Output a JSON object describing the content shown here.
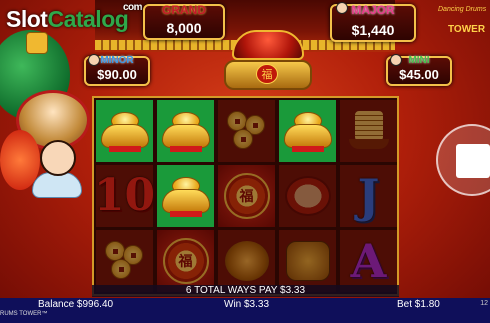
{
  "logo": {
    "slot": "Slot",
    "catalog": "Catalog",
    "com": "com"
  },
  "game_logo": {
    "line1": "Dancing Drums",
    "line2": "TOWER"
  },
  "jackpots": {
    "grand": {
      "title": "GRAND",
      "amount": "8,000"
    },
    "major": {
      "title": "MAJOR",
      "amount": "$1,440"
    },
    "minor": {
      "title": "MINOR",
      "amount": "$90.00"
    },
    "mini": {
      "title": "MINI",
      "amount": "$45.00"
    }
  },
  "box_symbol": "福",
  "reels": [
    [
      "gold-ingot",
      "ten",
      "lucky-coins"
    ],
    [
      "gold-ingot",
      "gold-ingot",
      "fu-medallion"
    ],
    [
      "lucky-coins",
      "fu-medallion",
      "peony"
    ],
    [
      "gold-ingot",
      "drum",
      "lion-dog"
    ],
    [
      "junk-boat",
      "J",
      "A"
    ]
  ],
  "symbol_text": {
    "ten": "10",
    "J": "J",
    "A": "A",
    "fu": "福"
  },
  "ways_message": "6 TOTAL WAYS PAY $3.33",
  "bottom_bar": {
    "balance": "Balance $996.40",
    "win": "Win $3.33",
    "bet": "Bet $1.80",
    "game_name": "RUMS TOWER™",
    "clock": "12"
  },
  "colors": {
    "bar": "#0f0f5a",
    "frame": "#d49a28",
    "winning_cell": "#1a9a3a"
  },
  "icons": {
    "spin_button": "stop-square-icon"
  }
}
